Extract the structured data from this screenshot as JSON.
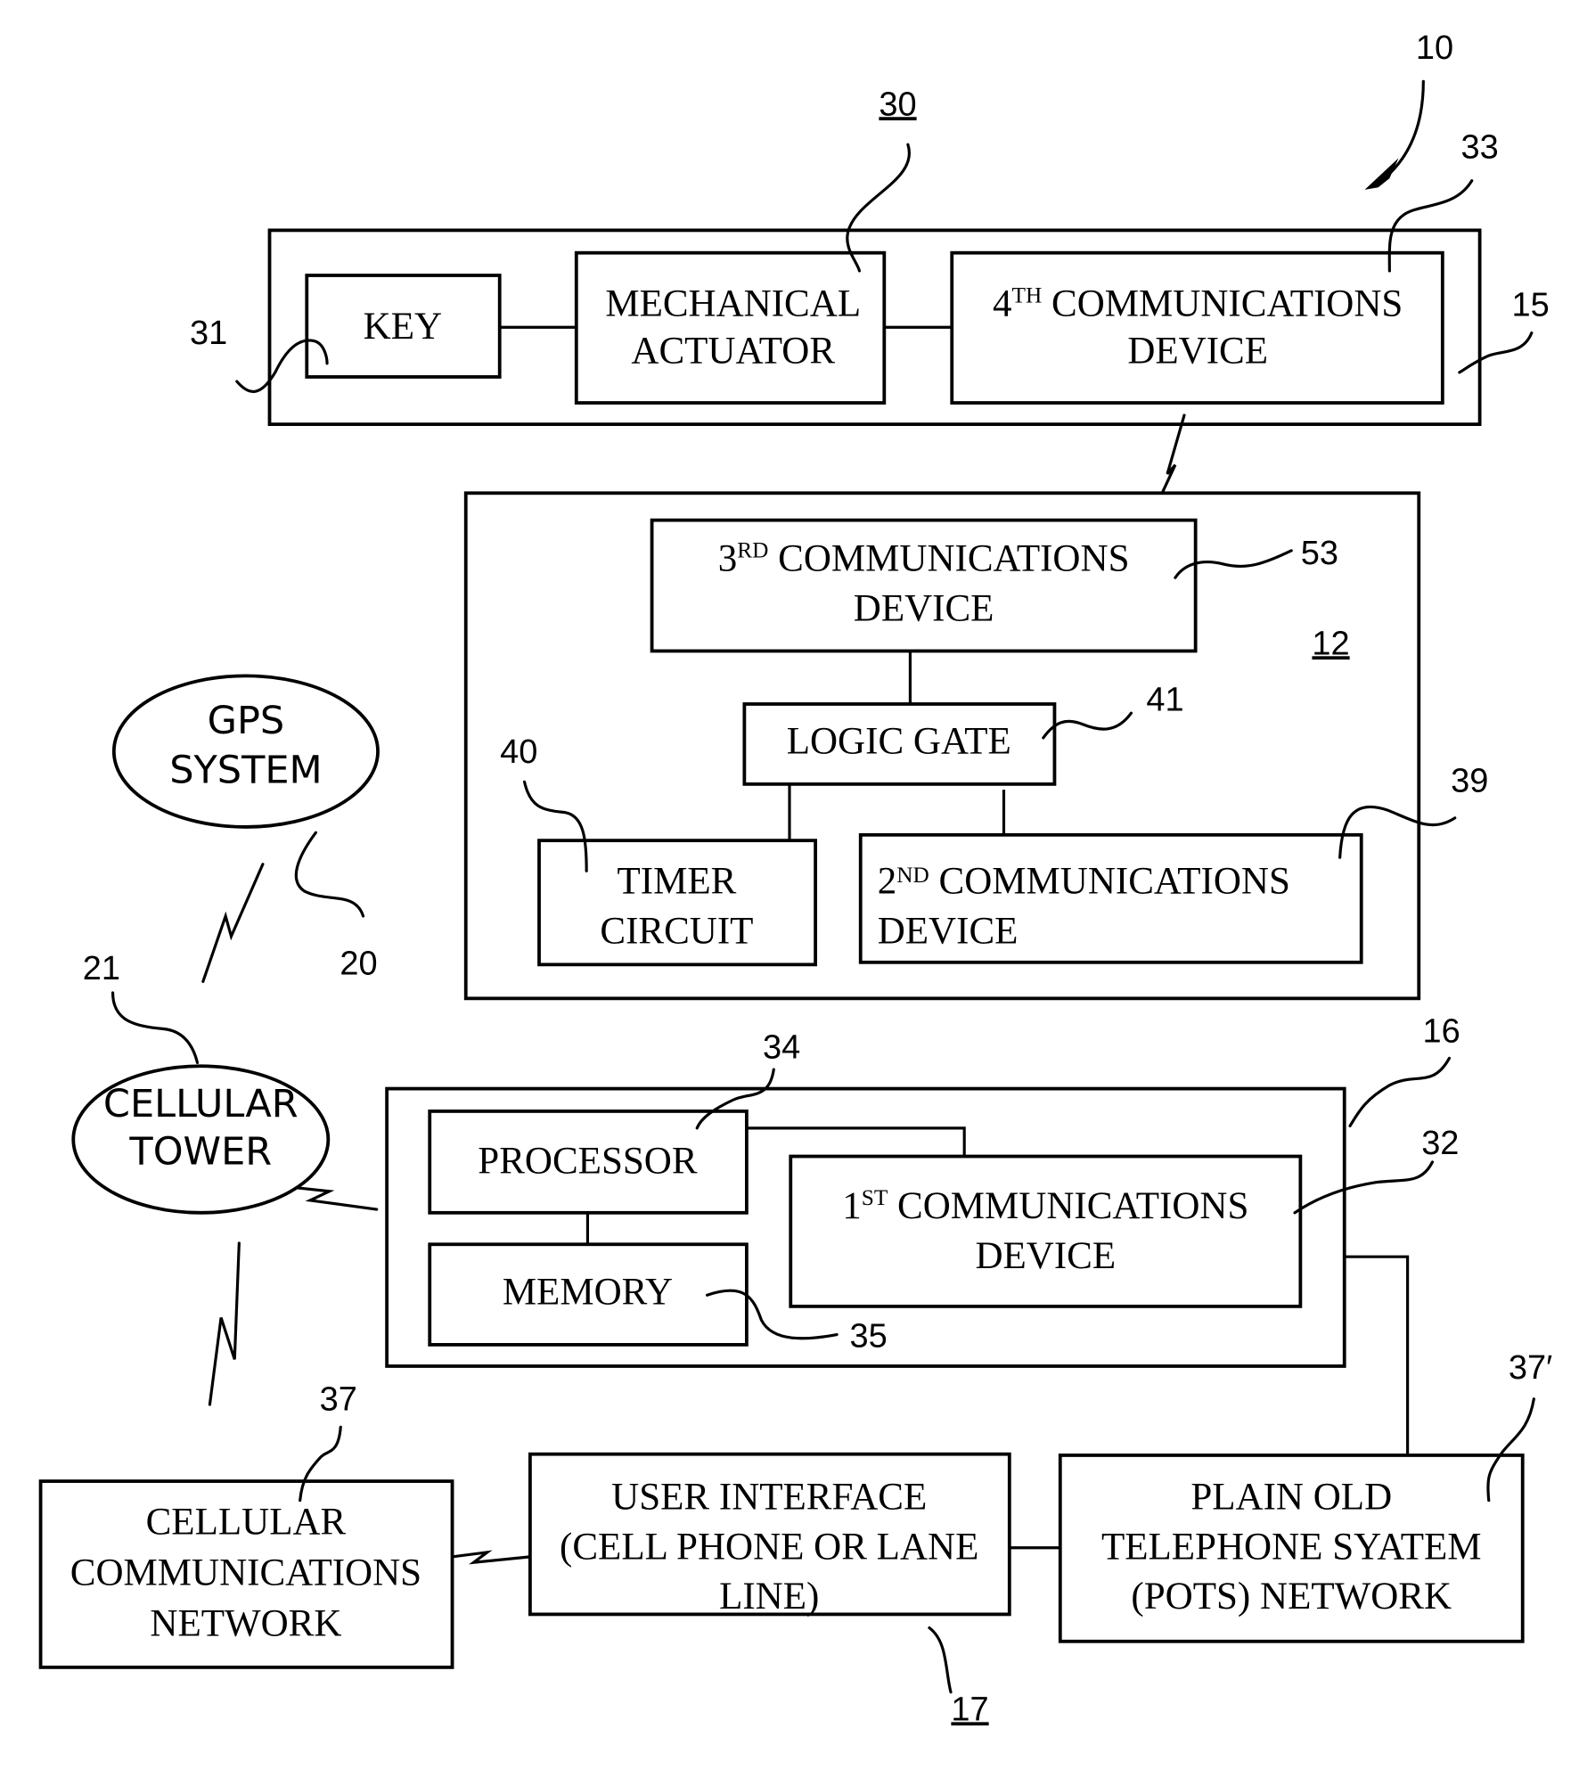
{
  "figure": {
    "system_ref": "10",
    "blocks": {
      "vehicle_unit": {
        "ref": "15",
        "key": {
          "label": "KEY",
          "ref": "31"
        },
        "mechanical_actuator": {
          "line1": "MECHANICAL",
          "line2": "ACTUATOR",
          "ref": "30"
        },
        "fourth_comm": {
          "prefix": "4",
          "sup": "TH",
          "line1": " COMMUNICATIONS",
          "line2": "DEVICE",
          "ref": "33"
        }
      },
      "control_unit": {
        "ref": "12",
        "third_comm": {
          "prefix": "3",
          "sup": "RD",
          "line1": " COMMUNICATIONS",
          "line2": "DEVICE",
          "ref": "53"
        },
        "logic_gate": {
          "label": "LOGIC GATE",
          "ref": "41"
        },
        "timer_circuit": {
          "line1": "TIMER",
          "line2": "CIRCUIT",
          "ref": "40"
        },
        "second_comm": {
          "prefix": "2",
          "sup": "ND",
          "line1": " COMMUNICATIONS",
          "line2": "DEVICE",
          "ref": "39"
        }
      },
      "gps": {
        "line1": "GPS",
        "line2": "SYSTEM",
        "ref": "20"
      },
      "cell_tower": {
        "line1": "CELLULAR",
        "line2": "TOWER",
        "ref": "21"
      },
      "base_unit": {
        "ref": "16",
        "processor": {
          "label": "PROCESSOR",
          "ref": "34"
        },
        "memory": {
          "label": "MEMORY",
          "ref": "35"
        },
        "first_comm": {
          "prefix": "1",
          "sup": "ST",
          "line1": " COMMUNICATIONS",
          "line2": "DEVICE",
          "ref": "32"
        }
      },
      "cellular_network": {
        "line1": "CELLULAR",
        "line2": "COMMUNICATIONS",
        "line3": "NETWORK",
        "ref": "37"
      },
      "user_interface": {
        "line1": "USER INTERFACE",
        "line2": "(CELL PHONE OR LANE",
        "line3": "LINE)",
        "ref": "17"
      },
      "pots": {
        "line1": "PLAIN OLD",
        "line2": "TELEPHONE SYATEM",
        "line3": "(POTS) NETWORK",
        "ref": "37′"
      }
    }
  }
}
